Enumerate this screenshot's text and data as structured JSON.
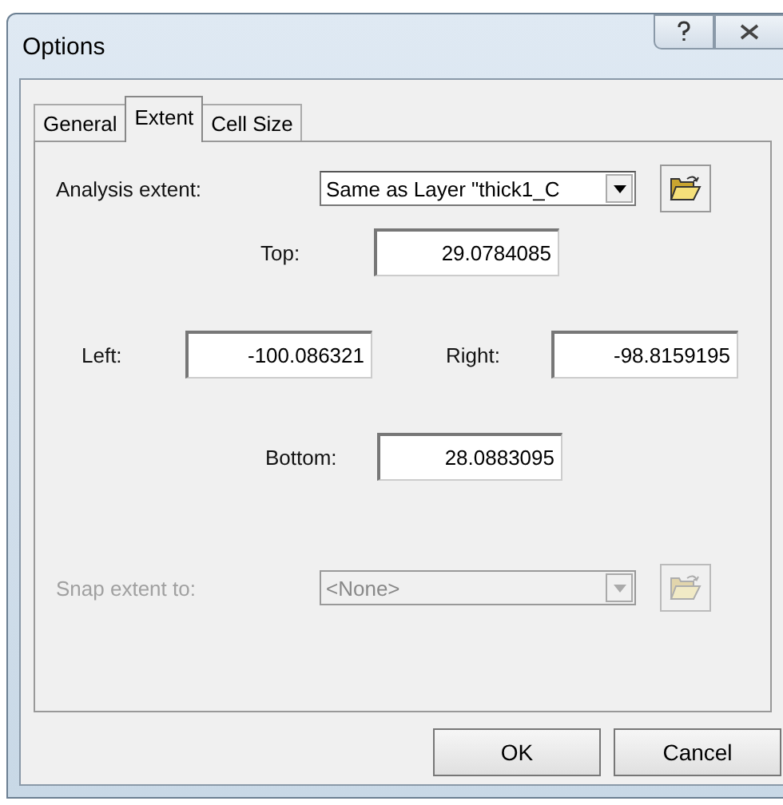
{
  "window": {
    "title": "Options"
  },
  "tabs": [
    {
      "label": "General",
      "selected": false
    },
    {
      "label": "Extent",
      "selected": true
    },
    {
      "label": "Cell Size",
      "selected": false
    }
  ],
  "analysis_extent": {
    "label": "Analysis extent:",
    "value": "Same as Layer \"thick1_C",
    "disabled": false
  },
  "top": {
    "label": "Top:",
    "value": "29.0784085"
  },
  "left": {
    "label": "Left:",
    "value": "-100.086321"
  },
  "right": {
    "label": "Right:",
    "value": "-98.8159195"
  },
  "bottom": {
    "label": "Bottom:",
    "value": "28.0883095"
  },
  "snap_extent": {
    "label": "Snap extent to:",
    "value": "<None>",
    "disabled": true
  },
  "buttons": [
    "OK",
    "Cancel"
  ]
}
